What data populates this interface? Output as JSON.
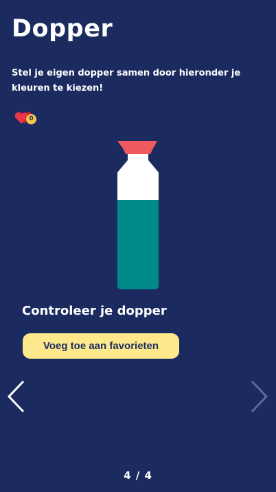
{
  "header": {
    "title": "Dopper",
    "subtitle": "Stel je eigen dopper samen door hieronder je kleuren te kiezen!"
  },
  "favorites": {
    "icon": "hearts-icon",
    "count": "0"
  },
  "bottle": {
    "cap_color": "#f05a5e",
    "neck_color": "#ffffff",
    "body_top_color": "#ffffff",
    "body_bottom_color": "#008b8a"
  },
  "review": {
    "label": "Controleer je dopper",
    "favorite_button": "Voeg toe aan favorieten"
  },
  "navigation": {
    "prev_icon": "chevron-left-icon",
    "next_icon": "chevron-right-icon",
    "next_disabled": true
  },
  "pager": {
    "text": "4 / 4"
  },
  "colors": {
    "background": "#1b2b60",
    "button": "#fde88b",
    "badge": "#f7c84a",
    "heart": "#e8384a"
  }
}
